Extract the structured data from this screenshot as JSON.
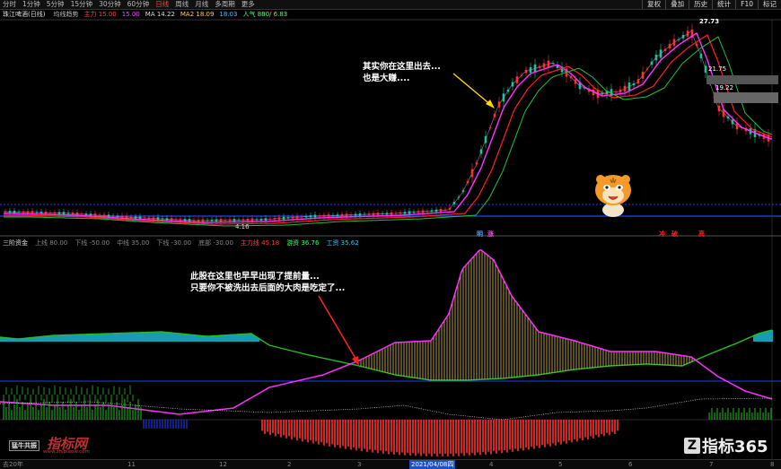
{
  "toolbar": {
    "periods": [
      "分时",
      "1分钟",
      "5分钟",
      "15分钟",
      "30分钟",
      "60分钟",
      "日线",
      "周线",
      "月线",
      "多周期",
      "更多"
    ],
    "active_index": 6,
    "right_buttons": [
      "复权",
      "叠加",
      "历史",
      "统计",
      "F10",
      "标记"
    ]
  },
  "main_panel": {
    "title": "珠江啤酒(日线)",
    "indicator_label": "均线趋势",
    "values": [
      "主力 15.00",
      "15.00",
      "MA 14.22",
      "MA2 18.09",
      "18.03",
      "人气 880/ 6.83"
    ],
    "price_labels": [
      "27.73",
      "21.75",
      "19.22"
    ],
    "low_label": "4.16"
  },
  "sub_panel": {
    "title": "三阶资金",
    "values": [
      "上线 80.00",
      "下线 -50.00",
      "中线 35.00",
      "下线 -30.00",
      "底部 -30.00",
      "主力线 45.18",
      "游资 36.76",
      "工资 35.62"
    ],
    "top_tags": [
      "明",
      "涨"
    ],
    "tags_red": [
      "冲",
      "破",
      "高"
    ]
  },
  "annotations": {
    "callout1": [
      "其实你在这里出去...",
      "也是大赚...."
    ],
    "callout2": [
      "此股在这里也早早出现了提前量...",
      "只要你不被洗出去后面的大肉是吃定了..."
    ]
  },
  "bottom_axis": {
    "labels": [
      "去20年",
      "11",
      "12",
      "2",
      "3",
      "4",
      "5",
      "6",
      "7",
      "8"
    ],
    "date": "2021/04/08四"
  },
  "watermarks": {
    "left_logo": "指标网",
    "left_url": "www.zhibiaow.com",
    "right_logo": "指标365",
    "small_tag": "猛牛共振"
  },
  "colors": {
    "up": "#ff3030",
    "down": "#20c0a0",
    "ma_magenta": "#ff30ff",
    "ma_red": "#ff2020",
    "ma_green": "#20c040",
    "cyan": "#20d0f0",
    "yellow": "#ffe060",
    "blue_line": "#2040ff"
  }
}
